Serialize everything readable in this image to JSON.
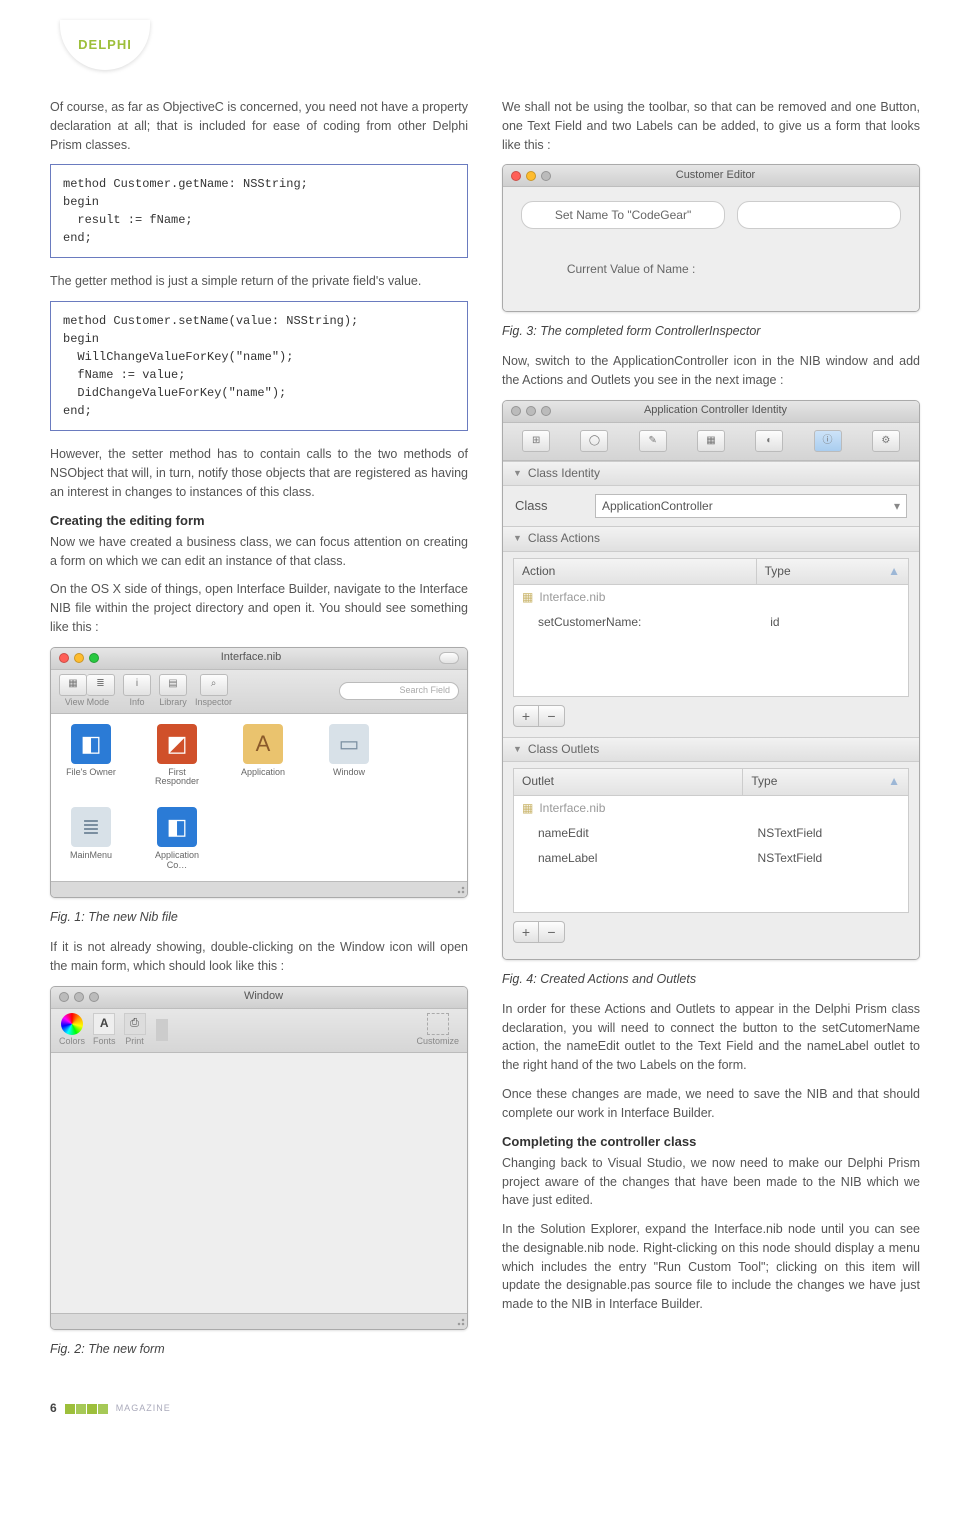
{
  "header": {
    "tab": "DELPHI"
  },
  "left": {
    "p1": "Of course, as far as ObjectiveC is concerned, you need not have a property declaration at all; that is included for ease of coding from other Delphi Prism classes.",
    "code1": "method Customer.getName: NSString;\nbegin\n  result := fName;\nend;",
    "p2": "The getter method is just a simple return of the private field's value.",
    "code2": "method Customer.setName(value: NSString);\nbegin\n  WillChangeValueForKey(\"name\");\n  fName := value;\n  DidChangeValueForKey(\"name\");\nend;",
    "p3": "However, the setter method has to contain calls to the two methods of NSObject that will, in turn, notify those objects that are registered as having an interest in changes to instances of this class.",
    "h1": "Creating the editing form",
    "p4": "Now we have created a business class, we can focus attention on creating a form on which we can edit an instance of that class.",
    "p5": "On the OS X side of things, open Interface Builder, navigate to the Interface NIB file within the project directory and open it. You should see something like this :",
    "fig1": {
      "title": "Interface.nib",
      "tb": [
        "View Mode",
        "Info",
        "Library",
        "Inspector"
      ],
      "search": "Search Field",
      "icons": [
        {
          "name": "File's Owner",
          "color": "#2b7bd6",
          "glyph": "◧"
        },
        {
          "name": "First Responder",
          "color": "#d0502a",
          "glyph": "◩"
        },
        {
          "name": "Application",
          "color": "#b5864a",
          "glyph": "A"
        },
        {
          "name": "Window",
          "color": "#b0bcc6",
          "glyph": "▭"
        },
        {
          "name": "MainMenu",
          "color": "#b0bcc6",
          "glyph": "≣"
        },
        {
          "name": "Application Co…",
          "color": "#2b7bd6",
          "glyph": "◧"
        }
      ]
    },
    "cap1": "Fig. 1: The new Nib file",
    "p6": "If it is not already showing, double-clicking on the Window icon will open the main form, which should look like this :",
    "fig2": {
      "title": "Window",
      "toolbar": [
        "Colors",
        "Fonts",
        "Print",
        "Customize"
      ]
    },
    "cap2": "Fig. 2: The new form"
  },
  "right": {
    "p1": "We shall not be using the toolbar, so that can be removed and one Button, one Text Field and two Labels can be added, to give us a form that looks like this :",
    "fig3": {
      "title": "Customer Editor",
      "button": "Set Name To \"CodeGear\"",
      "label": "Current Value of Name :"
    },
    "cap3": "Fig. 3: The completed form ControllerInspector",
    "p2": "Now, switch to the ApplicationController icon in the NIB window and add the Actions and Outlets you see in the next image :",
    "fig4": {
      "title": "Application Controller Identity",
      "classIdentity": "Class Identity",
      "classLabel": "Class",
      "classValue": "ApplicationController",
      "actionsHeader": "Class Actions",
      "actionsCols": [
        "Action",
        "Type"
      ],
      "actionsFile": "Interface.nib",
      "actions": [
        {
          "name": "setCustomerName:",
          "type": "id"
        }
      ],
      "outletsHeader": "Class Outlets",
      "outletsCols": [
        "Outlet",
        "Type"
      ],
      "outletsFile": "Interface.nib",
      "outlets": [
        {
          "name": "nameEdit",
          "type": "NSTextField"
        },
        {
          "name": "nameLabel",
          "type": "NSTextField"
        }
      ]
    },
    "cap4": "Fig. 4: Created Actions and Outlets",
    "p3": "In order for these Actions and Outlets to appear in the Delphi Prism class declaration, you will need to connect the button to the setCutomerName action, the nameEdit outlet to the Text Field and the nameLabel outlet to the right hand of the two Labels on the form.",
    "p4": "Once these changes are made, we need to save the NIB and that should complete our work in Interface Builder.",
    "h2": "Completing the controller class",
    "p5": "Changing back to Visual Studio, we now need to make our Delphi Prism project aware of the changes that have been made to the NIB which we have just edited.",
    "p6": "In the Solution Explorer, expand the Interface.nib node until you can see the designable.nib node. Right-clicking on this node should display a menu which includes the entry \"Run Custom Tool\"; clicking on this item will update the designable.pas source file to include the changes we have just made to the NIB in Interface Builder."
  },
  "footer": {
    "page": "6",
    "magazine": "MAGAZINE"
  }
}
